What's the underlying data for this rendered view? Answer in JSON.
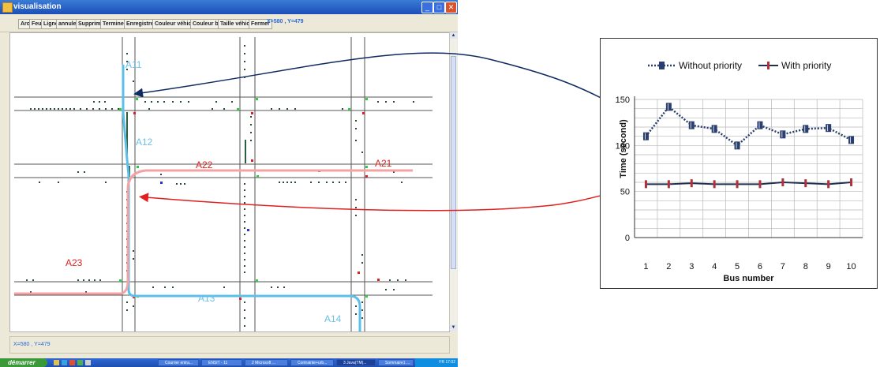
{
  "window": {
    "title": "visualisation",
    "controls": [
      "_",
      "□",
      "✕"
    ]
  },
  "toolbar": {
    "buttons": [
      "Arc",
      "Feu",
      "Ligne",
      "annuler",
      "Supprimer",
      "Terminer",
      "Enregistrer",
      "Couleur véhicule",
      "Couleur bus",
      "Taille véhicule",
      "Fermer"
    ],
    "coords": "X=580 , Y=479"
  },
  "statusbar": {
    "coords": "X=580 , Y=479"
  },
  "map": {
    "labels": {
      "a11": "A11",
      "a12": "A12",
      "a13": "A13",
      "a14": "A14",
      "a21": "A21",
      "a22": "A22",
      "a23": "A23"
    },
    "colors": {
      "route_blue": "#5bbfea",
      "route_red": "#f3a3a3",
      "road_line": "#555555"
    }
  },
  "taskbar": {
    "start": "démarrer",
    "tasks": [
      "Courrier entra...",
      "ENSIT - 11",
      "2 Microsoft ...",
      "Contrainte+urb...",
      "3 Java(TM)...",
      "Sommaire1 ..."
    ],
    "clock": "FR  17:02"
  },
  "arrows": {
    "blue": "#0f2a60",
    "red": "#e02020"
  },
  "chart_data": {
    "type": "line",
    "x": [
      1,
      2,
      3,
      4,
      5,
      6,
      7,
      8,
      9,
      10
    ],
    "xlabel": "Bus number",
    "ylabel": "Time (second)",
    "ylim": [
      0,
      150
    ],
    "yticks": [
      0,
      50,
      100,
      150
    ],
    "grid": true,
    "legend_position": "top",
    "series": [
      {
        "name": "Without priority",
        "values": [
          110,
          142,
          122,
          118,
          100,
          122,
          112,
          118,
          119,
          106
        ],
        "color": "#2a3f6f",
        "style": "dotted"
      },
      {
        "name": "With priority",
        "values": [
          58,
          58,
          59,
          58,
          58,
          58,
          60,
          59,
          58,
          60
        ],
        "color": "#1f3050",
        "style": "solid"
      }
    ]
  }
}
